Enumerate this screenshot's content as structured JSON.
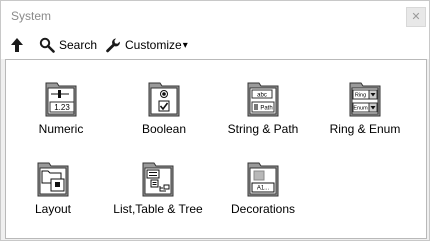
{
  "window": {
    "title": "System",
    "close_glyph": "✕"
  },
  "toolbar": {
    "up_icon": "arrow-up-icon",
    "search_label": "Search",
    "customize_label": "Customize",
    "customize_caret": "▾"
  },
  "palette": {
    "items": [
      {
        "label": "Numeric",
        "icon": "numeric-icon"
      },
      {
        "label": "Boolean",
        "icon": "boolean-icon"
      },
      {
        "label": "String & Path",
        "icon": "string-path-icon"
      },
      {
        "label": "Ring & Enum",
        "icon": "ring-enum-icon"
      },
      {
        "label": "Layout",
        "icon": "layout-icon"
      },
      {
        "label": "List,Table & Tree",
        "icon": "list-table-tree-icon"
      },
      {
        "label": "Decorations",
        "icon": "decorations-icon"
      }
    ]
  },
  "icon_text": {
    "numeric_value": "1.23",
    "string_value": "abc",
    "path_value": "Path",
    "ring_value": "Ring",
    "enum_value": "Enum",
    "decoration_value": "A1..."
  }
}
